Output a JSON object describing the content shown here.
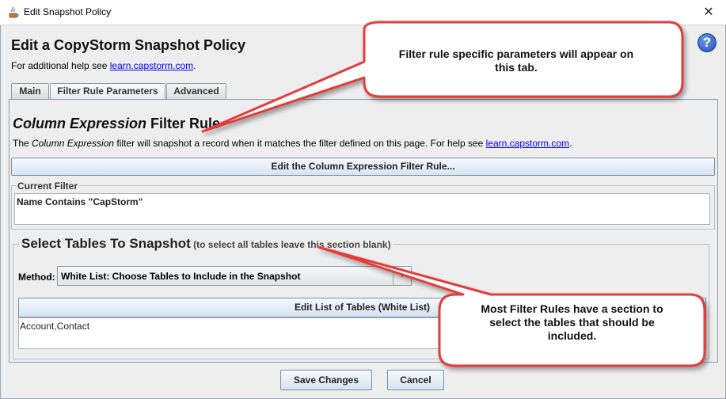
{
  "window": {
    "title": "Edit Snapshot Policy",
    "close_glyph": "✕"
  },
  "header": {
    "title": "Edit a CopyStorm Snapshot Policy",
    "help_prefix": "For additional help see ",
    "help_link": "learn.capstorm.com",
    "help_suffix": ".",
    "help_icon_glyph": "?"
  },
  "tabs": [
    {
      "label": "Main",
      "selected": false
    },
    {
      "label": "Filter Rule Parameters",
      "selected": true
    },
    {
      "label": "Advanced",
      "selected": false
    }
  ],
  "filter_rule": {
    "title_italic": "Column Expression",
    "title_rest": " Filter Rule",
    "desc_prefix": "The ",
    "desc_italic": "Column Expression",
    "desc_middle": " filter will snapshot a record when it matches the filter defined on this page. For help see ",
    "desc_link": "learn.capstorm.com",
    "desc_suffix": ".",
    "edit_button": "Edit the Column Expression Filter Rule..."
  },
  "current_filter": {
    "label": "Current Filter",
    "value": "Name Contains \"CapStorm\""
  },
  "select_tables": {
    "title": "Select Tables To Snapshot",
    "note": " (to select all tables leave this section blank)",
    "method_label": "Method:",
    "method_value": "White List: Choose Tables to Include in the Snapshot",
    "edit_list_button": "Edit List of Tables (White List)",
    "tables_value": "Account,Contact"
  },
  "footer": {
    "save_label": "Save Changes",
    "cancel_label": "Cancel"
  },
  "callouts": {
    "tab_note": "Filter rule specific parameters will appear on this tab.",
    "rules_note": "Most Filter Rules have a section to select the tables that should be included."
  },
  "colors": {
    "callout_border": "#e53b3b",
    "callout_fill": "#ffffff",
    "link": "#0000ee",
    "help_icon": "#1f4fb5"
  }
}
